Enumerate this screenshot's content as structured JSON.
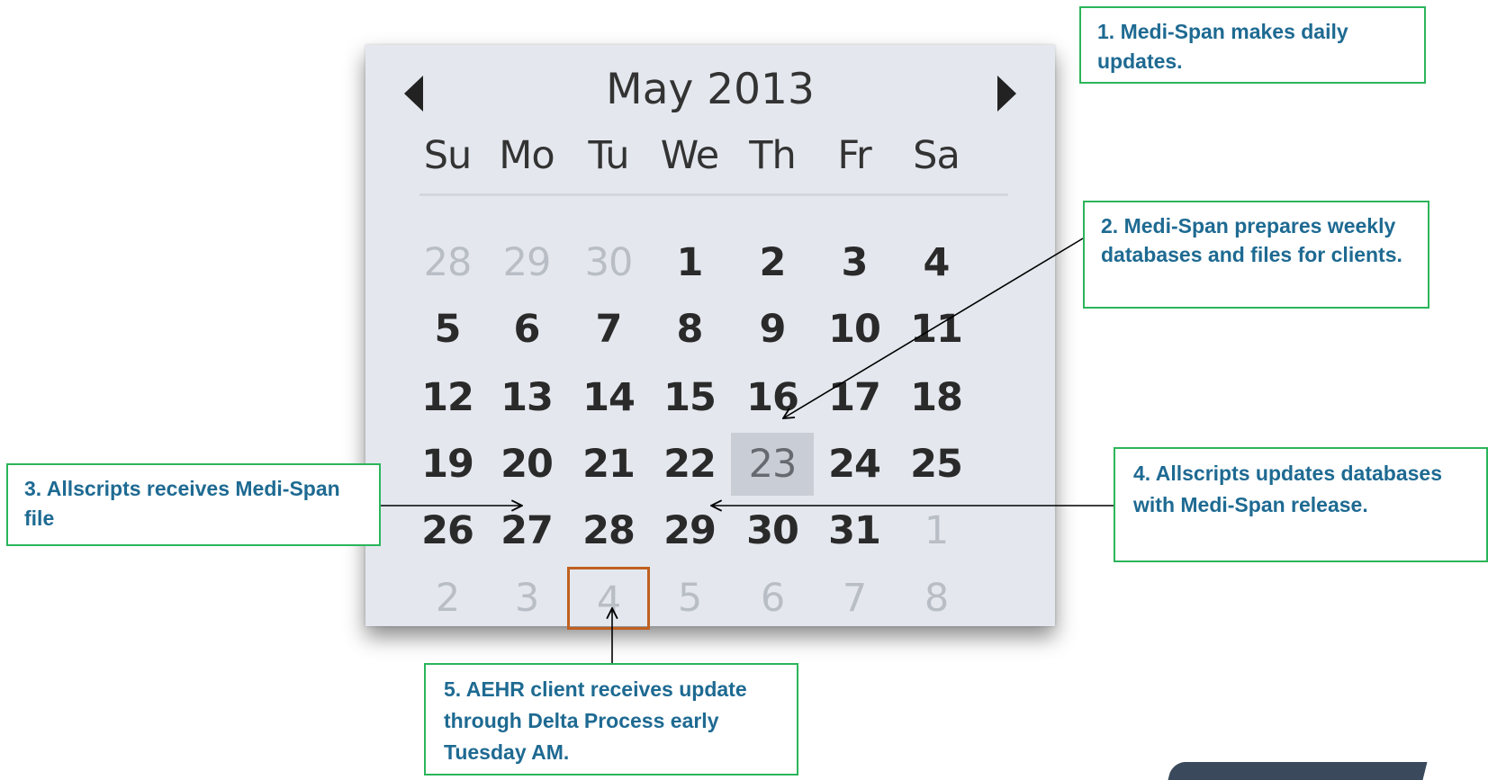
{
  "calendar": {
    "title": "May 2013",
    "prev_icon": "triangle-left-icon",
    "next_icon": "triangle-right-icon",
    "days_of_week": [
      "Su",
      "Mo",
      "Tu",
      "We",
      "Th",
      "Fr",
      "Sa"
    ],
    "weeks": [
      [
        "28",
        "29",
        "30",
        "1",
        "2",
        "3",
        "4"
      ],
      [
        "5",
        "6",
        "7",
        "8",
        "9",
        "10",
        "11"
      ],
      [
        "12",
        "13",
        "14",
        "15",
        "16",
        "17",
        "18"
      ],
      [
        "19",
        "20",
        "21",
        "22",
        "23",
        "24",
        "25"
      ],
      [
        "26",
        "27",
        "28",
        "29",
        "30",
        "31",
        "1"
      ],
      [
        "2",
        "3",
        "4",
        "5",
        "6",
        "7",
        "8"
      ]
    ],
    "outside_month": [
      [
        0,
        0
      ],
      [
        0,
        1
      ],
      [
        0,
        2
      ],
      [
        4,
        6
      ],
      [
        5,
        0
      ],
      [
        5,
        1
      ],
      [
        5,
        2
      ],
      [
        5,
        3
      ],
      [
        5,
        4
      ],
      [
        5,
        5
      ],
      [
        5,
        6
      ]
    ],
    "selected": [
      3,
      4
    ],
    "outlined": [
      5,
      2
    ]
  },
  "callouts": {
    "c1": "1. Medi-Span makes daily updates.",
    "c2": "2. Medi-Span prepares weekly databases and files for clients.",
    "c3": "3. Allscripts receives Medi-Span file",
    "c4": "4. Allscripts updates databases with Medi-Span release.",
    "c5": "5. AEHR client receives update through Delta Process early Tuesday AM."
  },
  "colors": {
    "callout_border": "#2bb55a",
    "callout_text": "#1e6a92",
    "outline_box": "#c0601f",
    "selected_bg": "#c9ced6"
  }
}
